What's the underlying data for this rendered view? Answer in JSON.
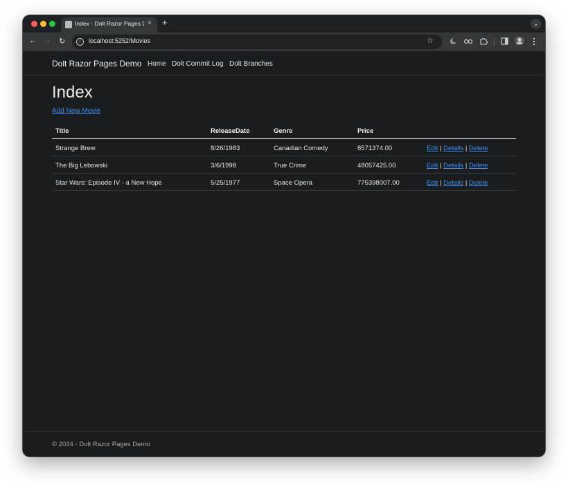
{
  "browser": {
    "tab_title": "Index - Dolt Razor Pages Demo",
    "tab_close": "×",
    "new_tab": "+",
    "tab_menu": "⌄",
    "url": "localhost:5252/Movies",
    "back": "←",
    "forward": "→",
    "reload": "↻",
    "star": "☆"
  },
  "navbar": {
    "brand": "Dolt Razor Pages Demo",
    "links": [
      "Home",
      "Dolt Commit Log",
      "Dolt Branches"
    ]
  },
  "main": {
    "heading": "Index",
    "add_link": "Add New Movie",
    "table": {
      "headers": [
        "Title",
        "ReleaseDate",
        "Genre",
        "Price"
      ],
      "rows": [
        {
          "title": "Strange Brew",
          "release_date": "8/26/1983",
          "genre": "Canadian Comedy",
          "price": "8571374.00"
        },
        {
          "title": "The Big Lebowski",
          "release_date": "3/6/1998",
          "genre": "True Crime",
          "price": "48057425.00"
        },
        {
          "title": "Star Wars: Episode IV - a New Hope",
          "release_date": "5/25/1977",
          "genre": "Space Opera",
          "price": "775398007.00"
        }
      ],
      "actions": {
        "edit": "Edit",
        "details": "Details",
        "delete": "Delete",
        "separator": "|"
      }
    }
  },
  "footer": {
    "text": "© 2024 - Dolt Razor Pages Demo"
  },
  "colors": {
    "page_bg": "#1b1c1e",
    "link": "#3b8ff3",
    "text": "#e6e6e6"
  }
}
